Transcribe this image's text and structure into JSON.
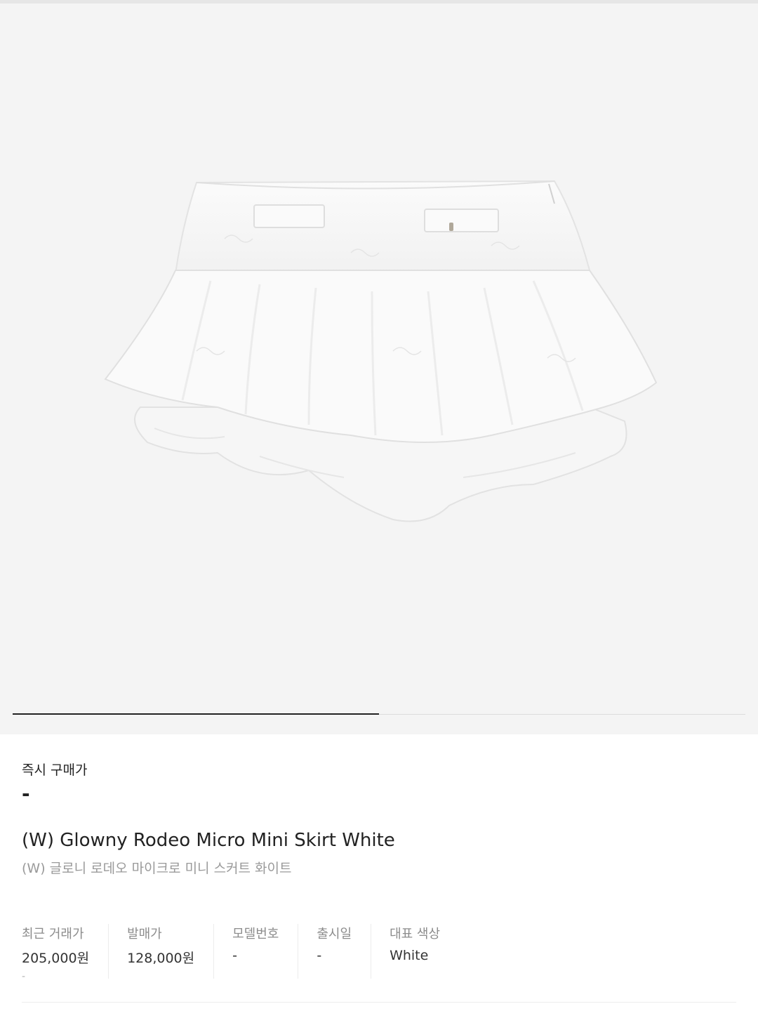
{
  "gallery": {
    "progress": 0.5
  },
  "instant_buy": {
    "label": "즉시 구매가",
    "value": "-"
  },
  "product": {
    "name_en": "(W) Glowny Rodeo Micro Mini Skirt White",
    "name_ko": "(W) 글로니 로데오 마이크로 미니 스커트 화이트"
  },
  "details": [
    {
      "label": "최근 거래가",
      "value": "205,000원",
      "sub": "-"
    },
    {
      "label": "발매가",
      "value": "128,000원"
    },
    {
      "label": "모델번호",
      "value": "-"
    },
    {
      "label": "출시일",
      "value": "-"
    },
    {
      "label": "대표 색상",
      "value": "White"
    }
  ]
}
